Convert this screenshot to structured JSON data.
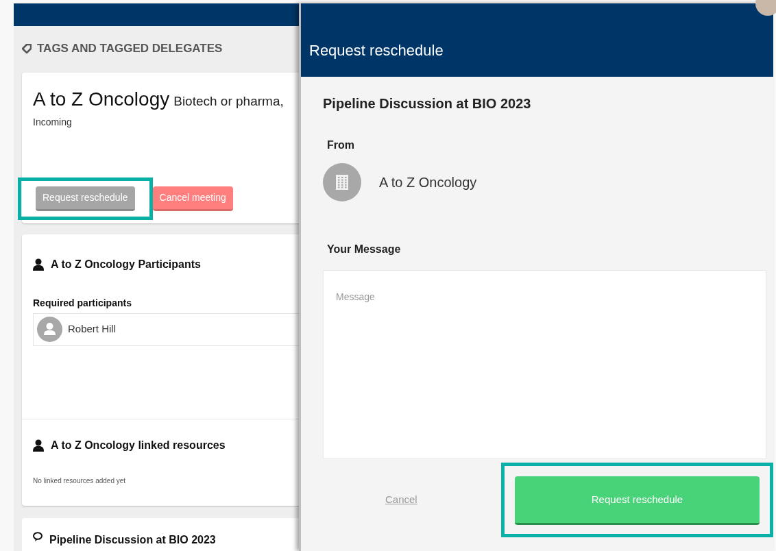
{
  "left_panel": {
    "heading": "TAGS AND TAGGED DELEGATES",
    "meeting_card": {
      "company": "A to Z Oncology",
      "category": "Biotech or pharma,",
      "direction": "Incoming",
      "buttons": [
        {
          "label": "Request reschedule",
          "kind": "reschedule",
          "disabled": true,
          "highlighted": true
        },
        {
          "label": "Cancel meeting",
          "kind": "cancel",
          "disabled": false,
          "highlighted": false
        }
      ]
    },
    "participants_card": {
      "title": "A to Z Oncology Participants",
      "required_label": "Required participants",
      "participants": [
        "Robert Hill"
      ],
      "resources_title": "A to Z Oncology linked resources",
      "resources_empty": "No linked resources added yet"
    },
    "discussion_card": {
      "title": "Pipeline Discussion at BIO 2023"
    }
  },
  "drawer": {
    "title": "Request reschedule",
    "meeting_title": "Pipeline Discussion at BIO 2023",
    "from_label": "From",
    "from_name": "A to Z Oncology",
    "message_label": "Your Message",
    "message": {
      "placeholder": "Message"
    },
    "cancel_link": "Cancel",
    "submit": {
      "label": "Request reschedule",
      "highlighted": true
    }
  }
}
